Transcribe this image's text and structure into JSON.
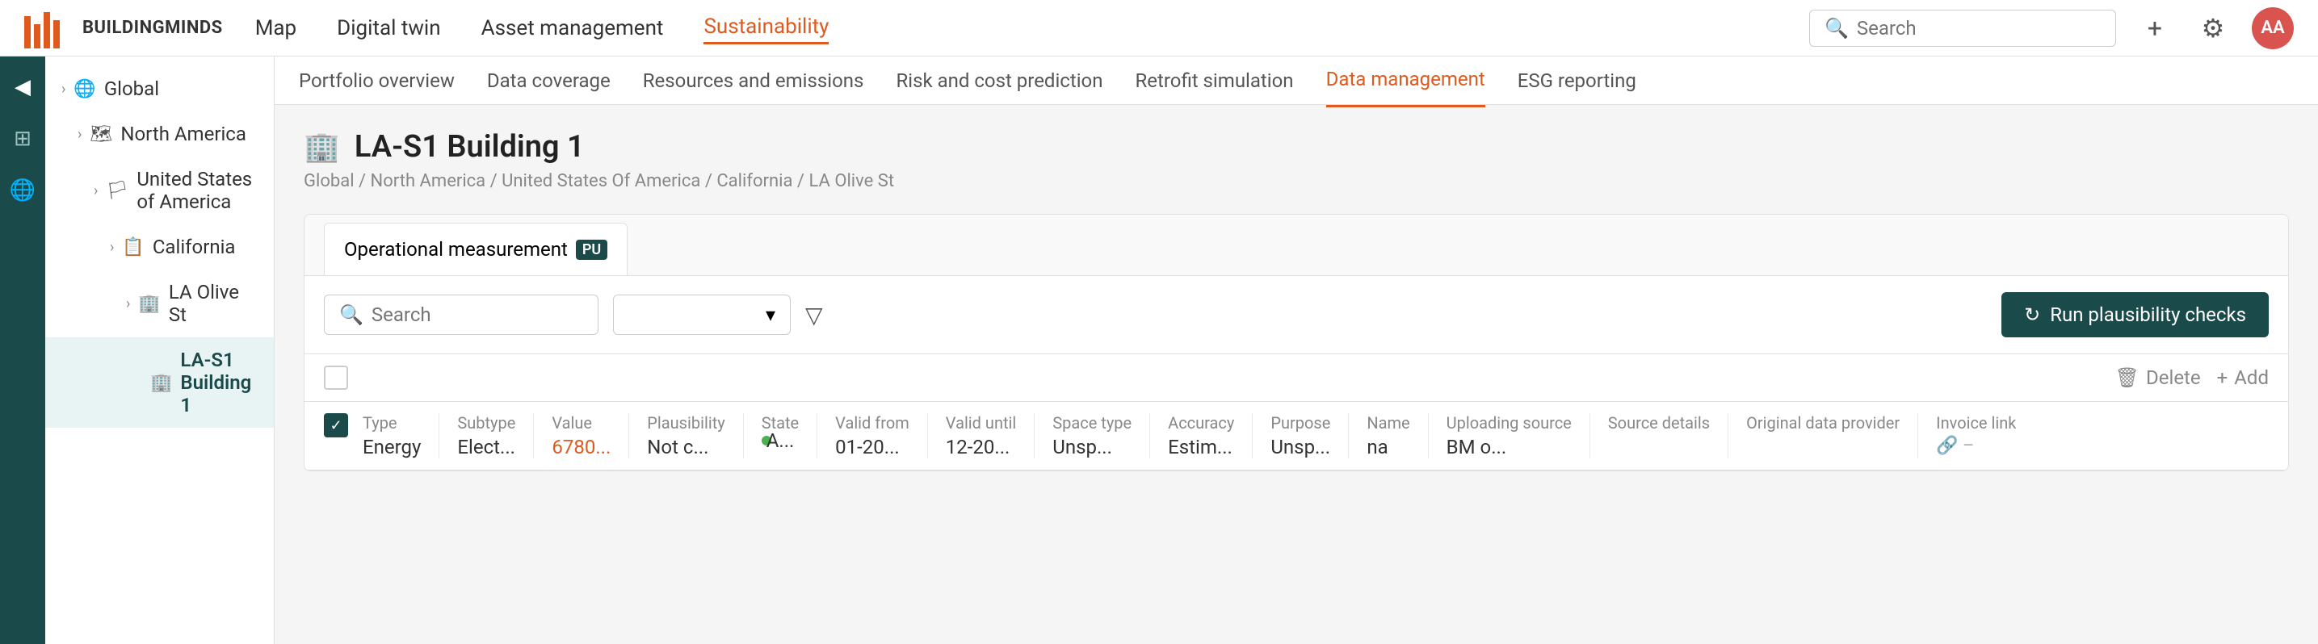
{
  "brand": {
    "name": "BUILDINGMINDS",
    "avatar": "AA"
  },
  "topNav": {
    "links": [
      {
        "label": "Map",
        "active": false
      },
      {
        "label": "Digital twin",
        "active": false
      },
      {
        "label": "Asset management",
        "active": false
      },
      {
        "label": "Sustainability",
        "active": true
      }
    ],
    "search_placeholder": "Search",
    "plus_label": "+",
    "settings_label": "⚙",
    "avatar_label": "AA"
  },
  "subNav": {
    "tabs": [
      {
        "label": "Portfolio overview",
        "active": false
      },
      {
        "label": "Data coverage",
        "active": false
      },
      {
        "label": "Resources and emissions",
        "active": false
      },
      {
        "label": "Risk and cost prediction",
        "active": false
      },
      {
        "label": "Retrofit simulation",
        "active": false
      },
      {
        "label": "Data management",
        "active": true
      },
      {
        "label": "ESG reporting",
        "active": false
      }
    ]
  },
  "sidebar": {
    "items": [
      {
        "label": "Global",
        "icon": "🌐",
        "level": 0
      },
      {
        "label": "North America",
        "icon": "🗺",
        "level": 1
      },
      {
        "label": "United States of America",
        "icon": "🏳",
        "level": 2
      },
      {
        "label": "California",
        "icon": "📋",
        "level": 3
      },
      {
        "label": "LA Olive St",
        "icon": "🏢",
        "level": 4
      },
      {
        "label": "LA-S1 Building 1",
        "icon": "🏢",
        "level": 5,
        "selected": true
      }
    ]
  },
  "page": {
    "title": "LA-S1 Building 1",
    "breadcrumb": "Global / North America / United States Of America / California / LA Olive St"
  },
  "card": {
    "tab_label": "Operational measurement",
    "tab_badge": "PU"
  },
  "toolbar": {
    "search_placeholder": "Search",
    "dropdown_placeholder": "",
    "filter_label": "▽",
    "run_button": "Run plausibility checks"
  },
  "table": {
    "delete_label": "Delete",
    "add_label": "Add",
    "row": {
      "type_label": "Type",
      "type_value": "Energy",
      "subtype_label": "Subtype",
      "subtype_value": "Elect...",
      "value_label": "Value",
      "value_value": "6780...",
      "plausibility_label": "Plausibility",
      "plausibility_value": "Not c...",
      "state_label": "State",
      "state_dot": "●",
      "state_value": "A...",
      "valid_from_label": "Valid from",
      "valid_from_value": "01-20...",
      "valid_until_label": "Valid until",
      "valid_until_value": "12-20...",
      "space_type_label": "Space type",
      "space_type_value": "Unsp...",
      "accuracy_label": "Accuracy",
      "accuracy_value": "Estim...",
      "purpose_label": "Purpose",
      "purpose_value": "Unsp...",
      "name_label": "Name",
      "name_value": "na",
      "uploading_source_label": "Uploading source",
      "uploading_source_value": "BM o...",
      "source_details_label": "Source details",
      "source_details_value": "",
      "original_data_provider_label": "Original data provider",
      "original_data_provider_value": "",
      "invoice_link_label": "Invoice link",
      "invoice_link_value": "🔗 –"
    }
  }
}
